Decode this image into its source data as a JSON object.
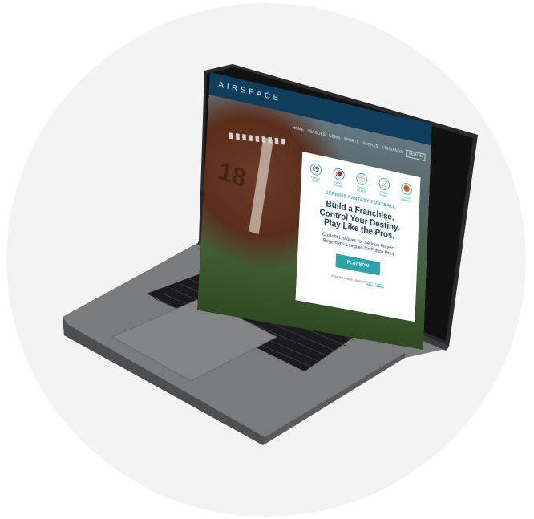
{
  "site": {
    "logo": "AIRSPACE",
    "nav": [
      "HOME",
      "LEAGUES",
      "NEWS",
      "SPORTS",
      "SCORES",
      "STANDINGS"
    ],
    "sign_in": "SIGN IN"
  },
  "hero": {
    "ball_text": "18",
    "icons": [
      {
        "icon": "soccer-ball-icon",
        "glyph": "⚽",
        "label": "Fantasy Soccer"
      },
      {
        "icon": "football-icon",
        "glyph": "🏈",
        "label": "Fantasy Football"
      },
      {
        "icon": "baseball-icon",
        "glyph": "⚾",
        "label": "Fantasy Baseball"
      },
      {
        "icon": "hockey-icon",
        "glyph": "🏒",
        "label": "Fantasy Hockey"
      },
      {
        "icon": "basketball-icon",
        "glyph": "🏀",
        "label": "Fantasy Basketball"
      }
    ],
    "tagline": "SERIOUS FANTASY FOOTBALL",
    "headline_1": "Build a Franchise.",
    "headline_2": "Control Your Destiny.",
    "headline_3": "Play Like the Pros.",
    "sub_1": "Custom Leagues for Serious Players",
    "sub_2": "Beginner's Leagues for Future Pros",
    "cta": "PLAY NOW",
    "footer_text": "Already Have a League?",
    "footer_link": "Sign In Here"
  },
  "colors": {
    "accent": "#2ba3a8",
    "navy": "#153a5c",
    "topbar": "#0f3d5c",
    "laptop_body": "#6d6e70"
  }
}
